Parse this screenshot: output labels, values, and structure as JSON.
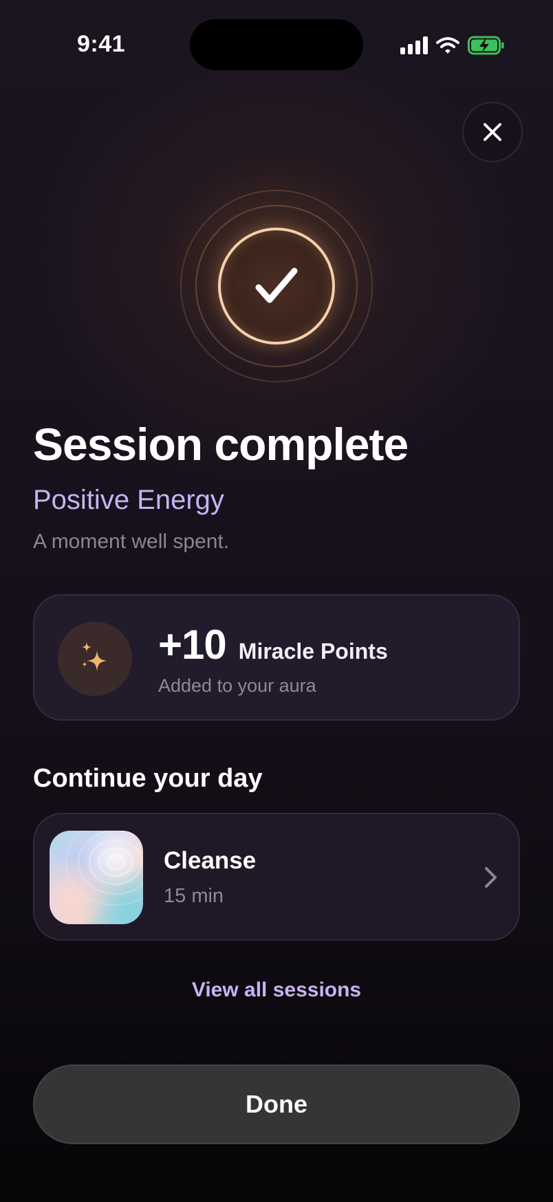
{
  "status_bar": {
    "time": "9:41",
    "icons": [
      "signal-icon",
      "wifi-icon",
      "battery-charging-icon"
    ]
  },
  "header": {
    "close_icon": "close-icon"
  },
  "hero": {
    "icon": "checkmark-icon",
    "title": "Session complete",
    "session_name": "Positive Energy",
    "note": "A moment well spent."
  },
  "points_card": {
    "icon": "sparkles-icon",
    "value": "+10",
    "unit": "Miracle Points",
    "caption": "Added to your aura"
  },
  "continue_section": {
    "title": "Continue your day",
    "items": [
      {
        "title": "Cleanse",
        "duration": "15 min",
        "thumbnail": "water-ripple-thumbnail",
        "icon": "chevron-right-icon"
      }
    ],
    "view_all_label": "View all sessions"
  },
  "footer": {
    "done_label": "Done"
  },
  "colors": {
    "accent_lavender": "#c7b3f2",
    "success_ring": "#f6d0aa",
    "sparkle": "#f2b46e",
    "button_bg": "#353535"
  }
}
